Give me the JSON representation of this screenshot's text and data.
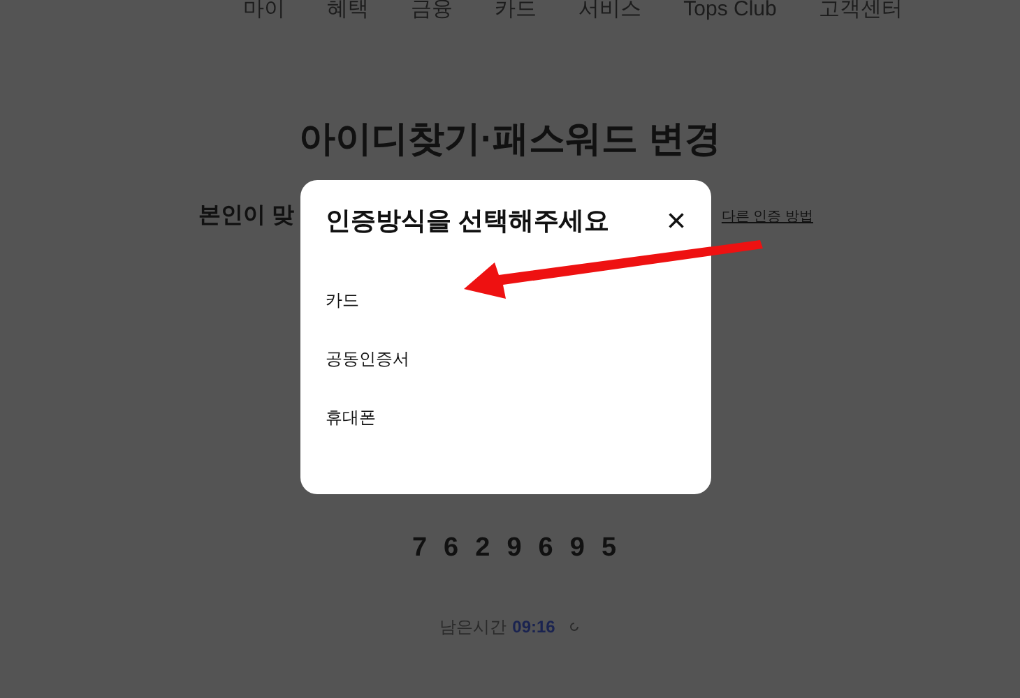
{
  "nav": {
    "items": [
      "마이",
      "혜택",
      "금융",
      "카드",
      "서비스",
      "Tops Club",
      "고객센터"
    ]
  },
  "page": {
    "title": "아이디찾기·패스워드 변경",
    "subtitle": "본인이 맞",
    "other_method_link": "다른 인증 방법",
    "code_digits": [
      "7",
      "6",
      "2",
      "9",
      "6",
      "9",
      "5"
    ],
    "timer_label": "남은시간",
    "timer_value": "09:16"
  },
  "dialog": {
    "title": "인증방식을 선택해주세요",
    "close": "×",
    "options": [
      "카드",
      "공동인증서",
      "휴대폰"
    ]
  },
  "annotation": {
    "kind": "arrow",
    "color": "#ee1111"
  }
}
